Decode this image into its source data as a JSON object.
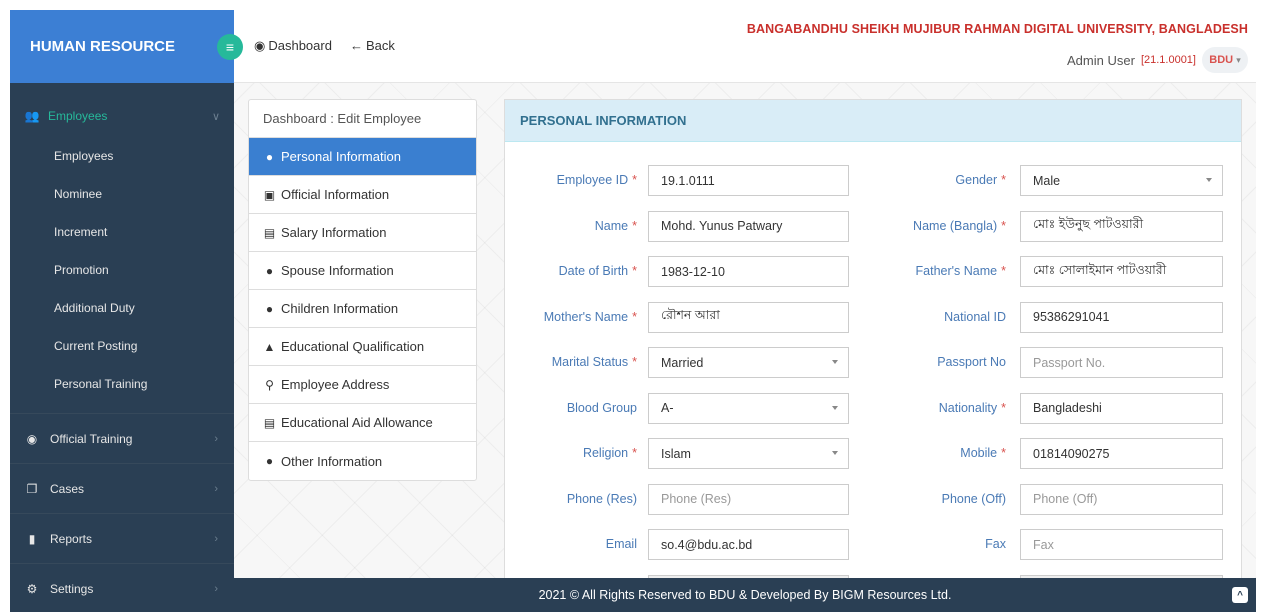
{
  "sidebar": {
    "brand": "HUMAN RESOURCE",
    "active_section": {
      "label": "Employees",
      "icon": "users-icon"
    },
    "sub_items": [
      "Employees",
      "Nominee",
      "Increment",
      "Promotion",
      "Additional Duty",
      "Current Posting",
      "Personal Training"
    ],
    "sections": [
      {
        "label": "Official Training",
        "icon": "globe-icon"
      },
      {
        "label": "Cases",
        "icon": "copy-icon"
      },
      {
        "label": "Reports",
        "icon": "file-icon"
      },
      {
        "label": "Settings",
        "icon": "cogs-icon"
      }
    ]
  },
  "topbar": {
    "dashboard": "Dashboard",
    "back": "Back",
    "university": "BANGABANDHU SHEIKH MUJIBUR RAHMAN DIGITAL UNIVERSITY, BANGLADESH",
    "user_name": "Admin User",
    "version": "[21.1.0001]",
    "logo_text": "BDU"
  },
  "menu": {
    "heading": "Dashboard : Edit Employee",
    "items": [
      {
        "label": "Personal Information",
        "icon": "user-icon"
      },
      {
        "label": "Official Information",
        "icon": "briefcase-icon"
      },
      {
        "label": "Salary Information",
        "icon": "money-icon"
      },
      {
        "label": "Spouse Information",
        "icon": "users-icon"
      },
      {
        "label": "Children Information",
        "icon": "users-icon"
      },
      {
        "label": "Educational Qualification",
        "icon": "graduation-cap-icon"
      },
      {
        "label": "Employee Address",
        "icon": "map-marker-icon"
      },
      {
        "label": "Educational Aid Allowance",
        "icon": "money-icon"
      },
      {
        "label": "Other Information",
        "icon": "user-icon"
      }
    ]
  },
  "panel": {
    "title": "PERSONAL INFORMATION",
    "left": [
      {
        "label": "Employee ID",
        "required": true,
        "value": "19.1.0111",
        "type": "text"
      },
      {
        "label": "Name",
        "required": true,
        "value": "Mohd. Yunus Patwary",
        "type": "text"
      },
      {
        "label": "Date of Birth",
        "required": true,
        "value": "1983-12-10",
        "type": "text"
      },
      {
        "label": "Mother's Name",
        "required": true,
        "value": "রৌশন আরা",
        "type": "text"
      },
      {
        "label": "Marital Status",
        "required": true,
        "value": "Married",
        "type": "select"
      },
      {
        "label": "Blood Group",
        "required": false,
        "value": "A-",
        "type": "select"
      },
      {
        "label": "Religion",
        "required": true,
        "value": "Islam",
        "type": "select"
      },
      {
        "label": "Phone (Res)",
        "required": false,
        "value": "",
        "placeholder": "Phone (Res)",
        "type": "text"
      },
      {
        "label": "Email",
        "required": false,
        "value": "so.4@bdu.ac.bd",
        "type": "text"
      }
    ],
    "right": [
      {
        "label": "Gender",
        "required": true,
        "value": "Male",
        "type": "select"
      },
      {
        "label": "Name (Bangla)",
        "required": true,
        "value": "মোঃ ইউনুছ পাটওয়ারী",
        "type": "text"
      },
      {
        "label": "Father's Name",
        "required": true,
        "value": "মোঃ সোলাইমান পাটওয়ারী",
        "type": "text"
      },
      {
        "label": "National ID",
        "required": false,
        "value": "95386291041",
        "type": "text"
      },
      {
        "label": "Passport No",
        "required": false,
        "value": "",
        "placeholder": "Passport No.",
        "type": "text"
      },
      {
        "label": "Nationality",
        "required": true,
        "value": "Bangladeshi",
        "type": "text"
      },
      {
        "label": "Mobile",
        "required": true,
        "value": "01814090275",
        "type": "text"
      },
      {
        "label": "Phone (Off)",
        "required": false,
        "value": "",
        "placeholder": "Phone (Off)",
        "type": "text"
      },
      {
        "label": "Fax",
        "required": false,
        "value": "",
        "placeholder": "Fax",
        "type": "text"
      }
    ]
  },
  "footer": {
    "text": "2021 © All Rights Reserved to BDU & Developed By BIGM Resources Ltd."
  },
  "colors": {
    "sidebar": "#2a3f54",
    "brand": "#3c7fd4",
    "accent": "#26b99a",
    "active_menu": "#3a7fd0",
    "required": "#d9534f",
    "panel_head": "#d9edf7"
  }
}
